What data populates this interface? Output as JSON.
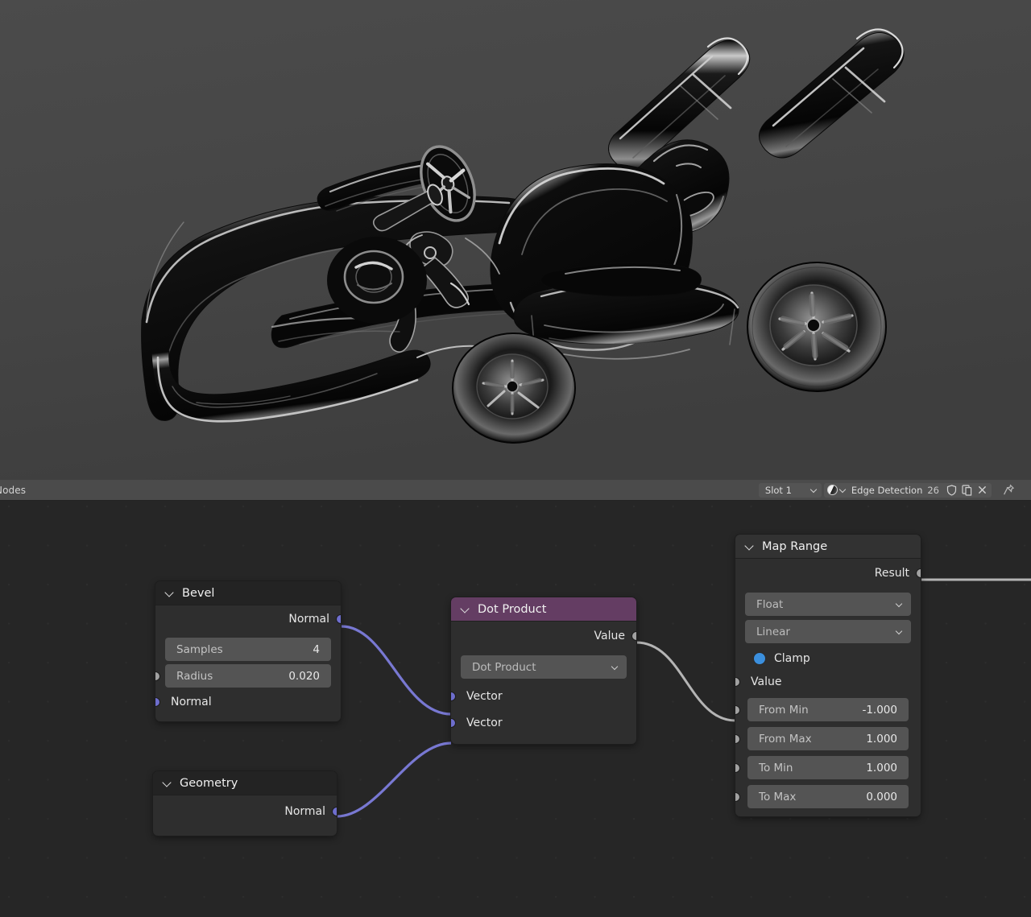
{
  "viewport": {
    "name": "3d-viewport",
    "subject": "go-kart-edge-detection-render",
    "background_color": "#454545"
  },
  "node_editor_header": {
    "editor_label": "Nodes",
    "slot_dropdown": {
      "value": "Slot 1"
    },
    "material": {
      "name": "Edge Detection",
      "users_count": "26"
    },
    "icons": {
      "material_preview": "material-sphere-icon",
      "fake_user": "shield-icon",
      "new_material": "duplicate-icon",
      "unlink": "close-icon",
      "pin": "pin-icon"
    }
  },
  "nodes": [
    {
      "id": "bevel",
      "title": "Bevel",
      "header_color": "#232323",
      "outputs": [
        {
          "label": "Normal",
          "socket": "vector"
        }
      ],
      "fields": [
        {
          "label": "Samples",
          "value": "4"
        },
        {
          "label": "Radius",
          "value": "0.020"
        }
      ],
      "inputs": [
        {
          "label": "Normal",
          "socket": "vector"
        }
      ]
    },
    {
      "id": "geometry",
      "title": "Geometry",
      "header_color": "#232323",
      "outputs": [
        {
          "label": "Normal",
          "socket": "vector"
        }
      ],
      "fields": [],
      "inputs": []
    },
    {
      "id": "dot-product",
      "title": "Dot Product",
      "header_color": "#643d63",
      "outputs": [
        {
          "label": "Value",
          "socket": "value"
        }
      ],
      "dropdowns": [
        {
          "value": "Dot Product"
        }
      ],
      "inputs": [
        {
          "label": "Vector",
          "socket": "vector"
        },
        {
          "label": "Vector",
          "socket": "vector"
        }
      ]
    },
    {
      "id": "map-range",
      "title": "Map Range",
      "header_color": "#323232",
      "outputs": [
        {
          "label": "Result",
          "socket": "value"
        }
      ],
      "dropdowns": [
        {
          "value": "Float"
        },
        {
          "value": "Linear"
        }
      ],
      "checkbox": {
        "label": "Clamp",
        "checked": true,
        "color": "#3b8fdd"
      },
      "inputs": [
        {
          "label": "Value",
          "socket": "value"
        }
      ],
      "fields": [
        {
          "label": "From Min",
          "value": "-1.000"
        },
        {
          "label": "From Max",
          "value": "1.000"
        },
        {
          "label": "To Min",
          "value": "1.000"
        },
        {
          "label": "To Max",
          "value": "0.000"
        }
      ]
    }
  ],
  "links": [
    {
      "from": "bevel.Normal",
      "to": "dot-product.Vector.0",
      "color": "#7878d2"
    },
    {
      "from": "geometry.Normal",
      "to": "dot-product.Vector.1",
      "color": "#7878d2"
    },
    {
      "from": "dot-product.Value",
      "to": "map-range.Value",
      "color": "#b4b4b4"
    },
    {
      "from": "map-range.Result",
      "to": "offscreen",
      "color": "#b4b4b4"
    }
  ]
}
